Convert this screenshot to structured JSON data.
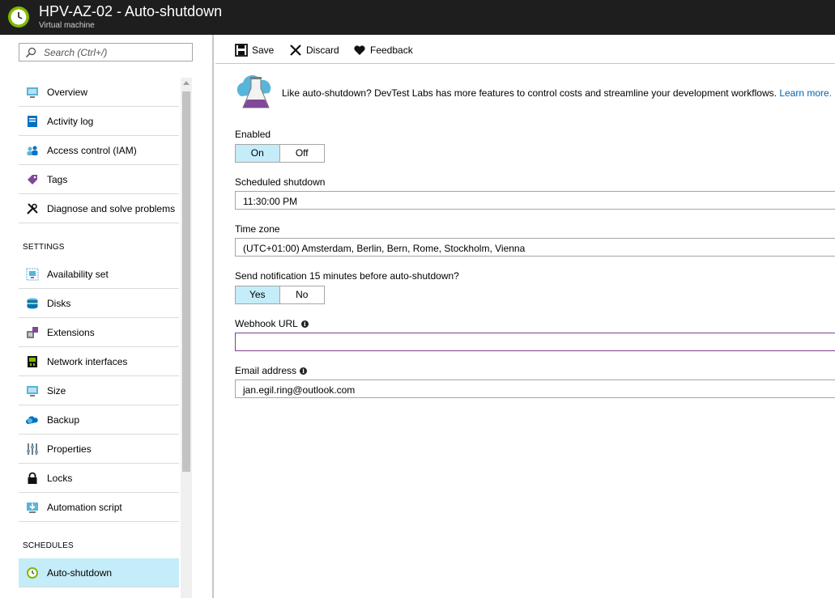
{
  "header": {
    "title": "HPV-AZ-02 - Auto-shutdown",
    "subtitle": "Virtual machine",
    "logo_icon": "clock-icon"
  },
  "search": {
    "placeholder": "Search (Ctrl+/)",
    "icon": "search-icon"
  },
  "sidebar": {
    "items_top": [
      {
        "label": "Overview",
        "icon": "overview-icon"
      },
      {
        "label": "Activity log",
        "icon": "activity-log-icon"
      },
      {
        "label": "Access control (IAM)",
        "icon": "access-control-icon"
      },
      {
        "label": "Tags",
        "icon": "tag-icon"
      },
      {
        "label": "Diagnose and solve problems",
        "icon": "wrench-icon"
      }
    ],
    "settings_label": "SETTINGS",
    "items_settings": [
      {
        "label": "Availability set",
        "icon": "availability-set-icon"
      },
      {
        "label": "Disks",
        "icon": "disk-icon"
      },
      {
        "label": "Extensions",
        "icon": "extensions-icon"
      },
      {
        "label": "Network interfaces",
        "icon": "network-interface-icon"
      },
      {
        "label": "Size",
        "icon": "monitor-icon"
      },
      {
        "label": "Backup",
        "icon": "cloud-backup-icon"
      },
      {
        "label": "Properties",
        "icon": "properties-icon"
      },
      {
        "label": "Locks",
        "icon": "lock-icon"
      },
      {
        "label": "Automation script",
        "icon": "download-icon"
      }
    ],
    "schedules_label": "SCHEDULES",
    "items_schedules": [
      {
        "label": "Auto-shutdown",
        "icon": "clock-icon",
        "active": true
      }
    ]
  },
  "toolbar": {
    "save_label": "Save",
    "discard_label": "Discard",
    "feedback_label": "Feedback"
  },
  "promo": {
    "text": "Like auto-shutdown? DevTest Labs has more features to control costs and streamline your development workflows.",
    "link": "Learn more."
  },
  "form": {
    "enabled_label": "Enabled",
    "enabled_on": "On",
    "enabled_off": "Off",
    "enabled_selected": "On",
    "shutdown_label": "Scheduled shutdown",
    "shutdown_value": "11:30:00 PM",
    "timezone_label": "Time zone",
    "timezone_value": "(UTC+01:00) Amsterdam, Berlin, Bern, Rome, Stockholm, Vienna",
    "notify_label": "Send notification 15 minutes before auto-shutdown?",
    "notify_yes": "Yes",
    "notify_no": "No",
    "notify_selected": "Yes",
    "webhook_label": "Webhook URL",
    "webhook_value": "",
    "email_label": "Email address",
    "email_value": "jan.egil.ring@outlook.com"
  },
  "colors": {
    "header_bg": "#1e1e1e",
    "active_bg": "#c4ecf9",
    "link": "#0063b1",
    "focus_border": "#7f3e98"
  }
}
